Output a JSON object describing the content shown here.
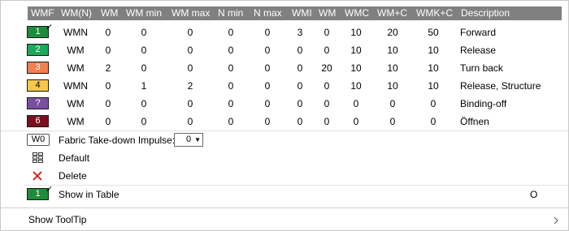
{
  "header": {
    "col_wmf": "WMF",
    "col_wmn": "WM(N)",
    "col_wm": "WM",
    "col_wm_min": "WM min",
    "col_wm_max": "WM max",
    "col_n_min": "N min",
    "col_n_max": "N max",
    "col_wmi": "WMI",
    "col_wm2": "WM",
    "col_wmc": "WMC",
    "col_wm_plus_c": "WM+C",
    "col_wmk_plus_c": "WMK+C",
    "col_description": "Description"
  },
  "rows": [
    {
      "swatch": "1",
      "color": "#1e8c3c",
      "checked": true,
      "wmn": "WMN",
      "wm": "0",
      "wm_min": "0",
      "wm_max": "0",
      "n_min": "0",
      "n_max": "0",
      "wmi": "3",
      "wm2": "0",
      "wmc": "10",
      "wm_plus_c": "20",
      "wmk_plus_c": "50",
      "description": "Forward"
    },
    {
      "swatch": "2",
      "color": "#1ea85a",
      "checked": false,
      "wmn": "WM",
      "wm": "0",
      "wm_min": "0",
      "wm_max": "0",
      "n_min": "0",
      "n_max": "0",
      "wmi": "0",
      "wm2": "0",
      "wmc": "10",
      "wm_plus_c": "10",
      "wmk_plus_c": "10",
      "description": "Release"
    },
    {
      "swatch": "3",
      "color": "#f08050",
      "checked": false,
      "wmn": "WM",
      "wm": "2",
      "wm_min": "0",
      "wm_max": "0",
      "n_min": "0",
      "n_max": "0",
      "wmi": "0",
      "wm2": "20",
      "wmc": "10",
      "wm_plus_c": "10",
      "wmk_plus_c": "10",
      "description": "Turn back"
    },
    {
      "swatch": "4",
      "color": "#f5c84a",
      "checked": false,
      "wmn": "WMN",
      "wm": "0",
      "wm_min": "1",
      "wm_max": "2",
      "n_min": "0",
      "n_max": "0",
      "wmi": "0",
      "wm2": "0",
      "wmc": "10",
      "wm_plus_c": "10",
      "wmk_plus_c": "10",
      "description": "Release, Structure"
    },
    {
      "swatch": "?",
      "color": "#7a4fa0",
      "checked": false,
      "wmn": "WM",
      "wm": "0",
      "wm_min": "0",
      "wm_max": "0",
      "n_min": "0",
      "n_max": "0",
      "wmi": "0",
      "wm2": "0",
      "wmc": "0",
      "wm_plus_c": "0",
      "wmk_plus_c": "0",
      "description": "Binding-off"
    },
    {
      "swatch": "6",
      "color": "#7a1020",
      "checked": false,
      "wmn": "WM",
      "wm": "0",
      "wm_min": "0",
      "wm_max": "0",
      "n_min": "0",
      "n_max": "0",
      "wmi": "0",
      "wm2": "0",
      "wmc": "0",
      "wm_plus_c": "0",
      "wmk_plus_c": "0",
      "description": "Öffnen"
    }
  ],
  "menu": {
    "w0_badge": "W0",
    "fabric_label": "Fabric Take-down Impulse:",
    "fabric_value": "0",
    "default_label": "Default",
    "delete_label": "Delete",
    "show_in_table_badge": "1",
    "show_in_table_label": "Show in Table",
    "show_in_table_value": "O",
    "show_tooltip_label": "Show ToolTip"
  },
  "colors": {
    "header_bg": "#808080",
    "delete_icon": "#d42a2a",
    "show_in_table_badge": "#1e8c3c"
  }
}
